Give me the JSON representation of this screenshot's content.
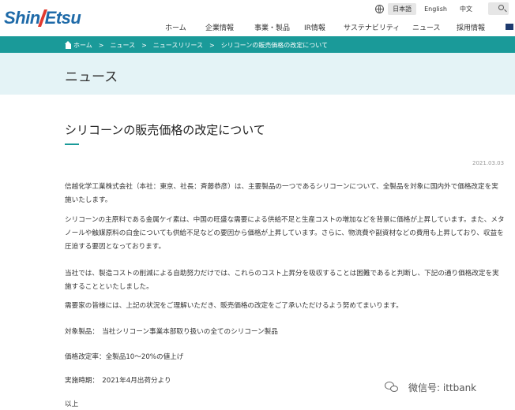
{
  "header": {
    "logo": {
      "part1": "Shin",
      "part2": "Etsu"
    },
    "languages": [
      "日本語",
      "English",
      "中文"
    ],
    "active_language": "日本語",
    "nav": [
      "ホーム",
      "企業情報",
      "事業・製品",
      "IR情報",
      "サステナビリティ",
      "ニュース",
      "採用情報"
    ]
  },
  "breadcrumb": [
    "ホーム",
    "ニュース",
    "ニュースリリース",
    "シリコーンの販売価格の改定について"
  ],
  "page_title": "ニュース",
  "article": {
    "title": "シリコーンの販売価格の改定について",
    "date": "2021.03.03",
    "paragraphs": [
      "信越化学工業株式会社（本社：東京、社長：斉藤恭彦）は、主要製品の一つであるシリコーンについて、全製品を対象に国内外で価格改定を実施いたします。",
      "シリコーンの主原料である金属ケイ素は、中国の旺盛な需要による供給不足と生産コストの増加などを背景に価格が上昇しています。また、メタノールや触媒原料の白金についても供給不足などの要因から価格が上昇しています。さらに、物流費や副資材などの費用も上昇しており、収益を圧迫する要因となっております。",
      "当社では、製造コストの削減による自助努力だけでは、これらのコスト上昇分を吸収することは困難であると判断し、下記の通り価格改定を実施することといたしました。",
      "需要家の皆様には、上記の状況をご理解いただき、販売価格の改定をご了承いただけるよう努めてまいります。",
      "対象製品：　当社シリコーン事業本部取り扱いの全てのシリコーン製品",
      "価格改定率：全製品10～20%の値上げ",
      "実施時期：　2021年4月出荷分より",
      "以上"
    ]
  },
  "watermark": "微信号: ittbank",
  "colors": {
    "brand_blue": "#1e6aa8",
    "teal": "#1a9a99",
    "title_band": "#e4f3f6"
  }
}
